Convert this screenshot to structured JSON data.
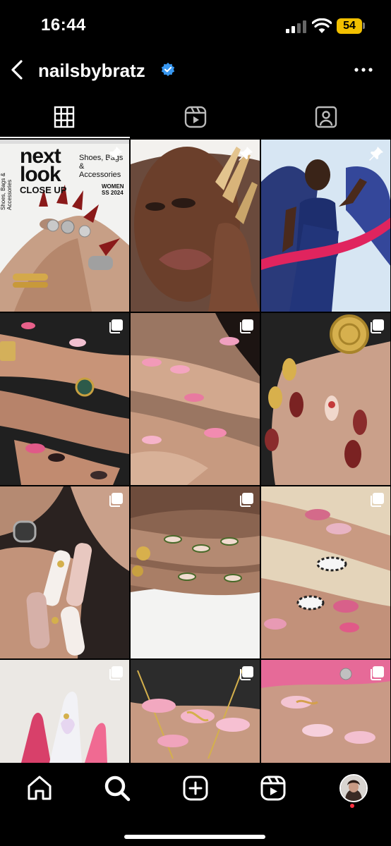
{
  "status_bar": {
    "time": "16:44",
    "battery": "54"
  },
  "header": {
    "username": "nailsbybratz"
  },
  "tabs": [
    {
      "name": "grid",
      "active": true
    },
    {
      "name": "reels",
      "active": false
    },
    {
      "name": "tagged",
      "active": false
    }
  ],
  "posts": [
    {
      "id": 1,
      "pinned": true,
      "cover": {
        "headline_1": "next",
        "headline_2": "look",
        "headline_3": "CLOSE UP",
        "side_text": "Shoes, Bags & Accessories",
        "right_text": "Shoes, Bags & Accessories",
        "season_1": "WOMEN",
        "season_2": "SS 2024"
      }
    },
    {
      "id": 2,
      "pinned": true
    },
    {
      "id": 3,
      "pinned": true
    },
    {
      "id": 4,
      "carousel": true
    },
    {
      "id": 5,
      "carousel": true
    },
    {
      "id": 6,
      "carousel": true
    },
    {
      "id": 7,
      "carousel": true
    },
    {
      "id": 8,
      "carousel": true
    },
    {
      "id": 9,
      "carousel": true
    },
    {
      "id": 10,
      "carousel": true
    },
    {
      "id": 11,
      "carousel": true
    },
    {
      "id": 12,
      "carousel": true
    }
  ],
  "bottom_nav": [
    "home",
    "search",
    "create",
    "reels",
    "profile"
  ],
  "colors": {
    "background": "#000000",
    "verified": "#3897f0",
    "battery": "#f2c000",
    "notification_dot": "#ff3040"
  }
}
